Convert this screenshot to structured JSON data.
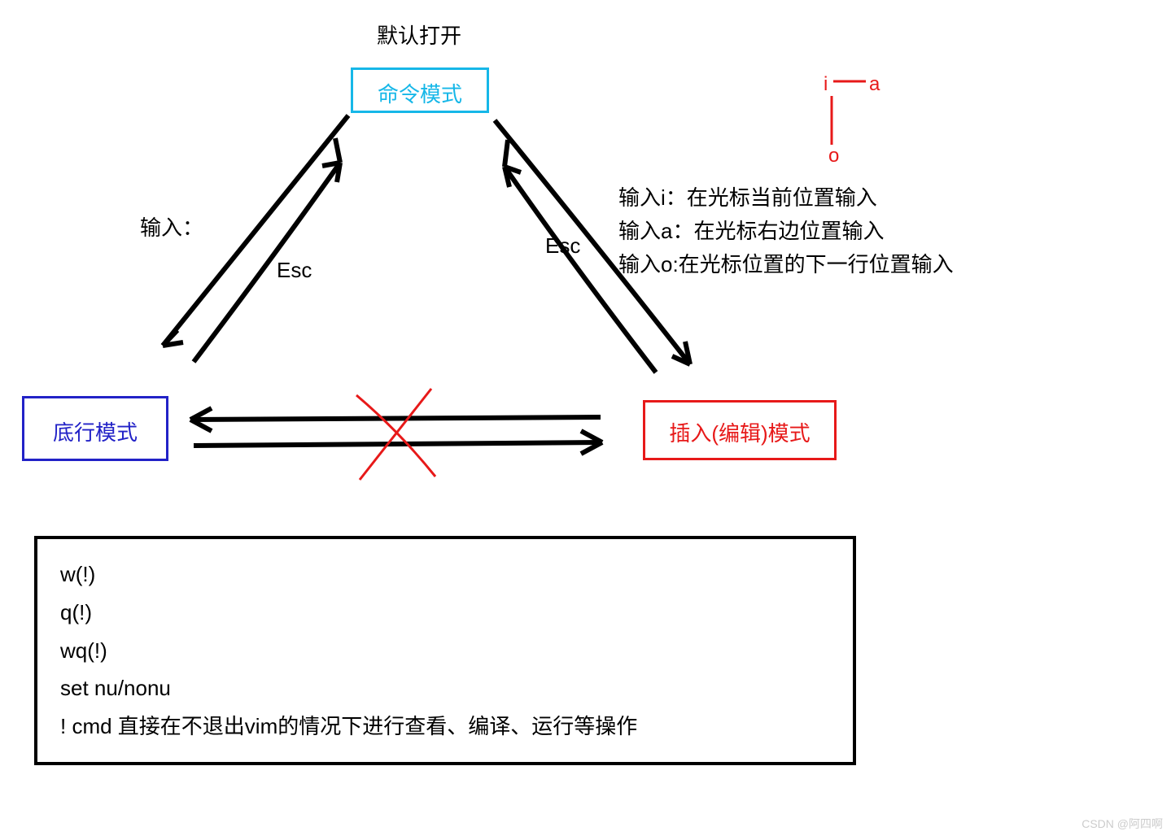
{
  "diagram": {
    "title_above_cmd": "默认打开",
    "modes": {
      "command": "命令模式",
      "bottomline": "底行模式",
      "insert": "插入(编辑)模式"
    },
    "edge_labels": {
      "to_bottomline": "输入：",
      "esc_left": "Esc",
      "esc_right": "Esc"
    },
    "right_hints": {
      "glyph_i": "i",
      "glyph_a": "a",
      "glyph_o": "o",
      "line_i": "输入i：在光标当前位置输入",
      "line_a": "输入a：在光标右边位置输入",
      "line_o": "输入o:在光标位置的下一行位置输入"
    },
    "bottom_commands": {
      "c1": "w(!)",
      "c2": "q(!)",
      "c3": "wq(!)",
      "c4": "set nu/nonu",
      "c5": "! cmd 直接在不退出vim的情况下进行查看、编译、运行等操作"
    }
  },
  "watermark": "CSDN @阿四啊"
}
